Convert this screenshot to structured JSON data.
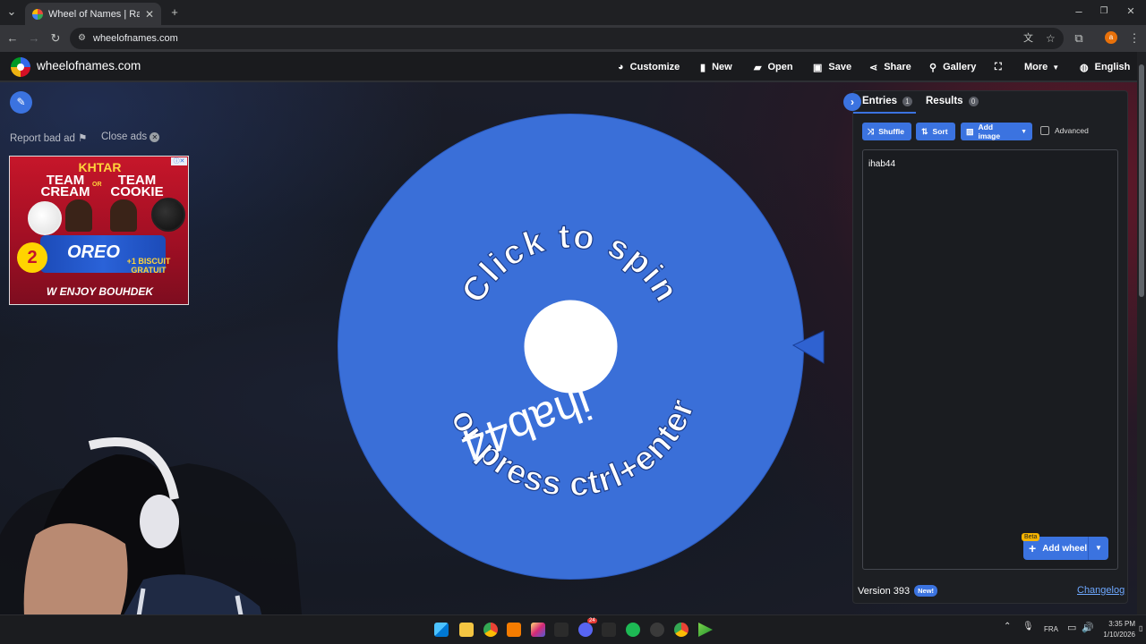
{
  "browser": {
    "tab_title": "Wheel of Names | Random name picker",
    "url": "wheelofnames.com",
    "profile_initial": "a"
  },
  "header": {
    "site_name": "wheelofnames.com",
    "menu": {
      "customize": "Customize",
      "new": "New",
      "open": "Open",
      "save": "Save",
      "share": "Share",
      "gallery": "Gallery",
      "more": "More",
      "language": "English"
    }
  },
  "ads": {
    "report_label": "Report bad ad",
    "close_label": "Close ads",
    "banner": {
      "brand_line": "KHTAR",
      "team_left": "TEAM CREAM",
      "team_right": "TEAM COOKIE",
      "or": "OR",
      "product": "OREO",
      "promo": "+1 BISCUIT GRATUIT",
      "big_number": "2",
      "tagline": "W ENJOY BOUHDEK"
    }
  },
  "wheel": {
    "top_text": "Click to spin",
    "bottom_text": "or press ctrl+enter",
    "entry_label": "ihab44",
    "colors": {
      "wheel": "#3a6fd8",
      "center": "#ffffff",
      "pointer": "#2f62d1"
    }
  },
  "panel": {
    "tab_entries": "Entries",
    "entries_count": "1",
    "tab_results": "Results",
    "results_count": "0",
    "shuffle_label": "Shuffle",
    "sort_label": "Sort",
    "add_image_label": "Add image",
    "advanced_label": "Advanced",
    "entries_text": "ihab44",
    "beta_label": "Beta",
    "add_wheel_label": "Add wheel",
    "version_label": "Version 393",
    "new_badge": "New!",
    "changelog_label": "Changelog"
  },
  "taskbar": {
    "language": "FRA",
    "time": "3:35 PM",
    "date": "1/10/2026",
    "discord_badge": "24"
  },
  "accent": "#3b73e0"
}
